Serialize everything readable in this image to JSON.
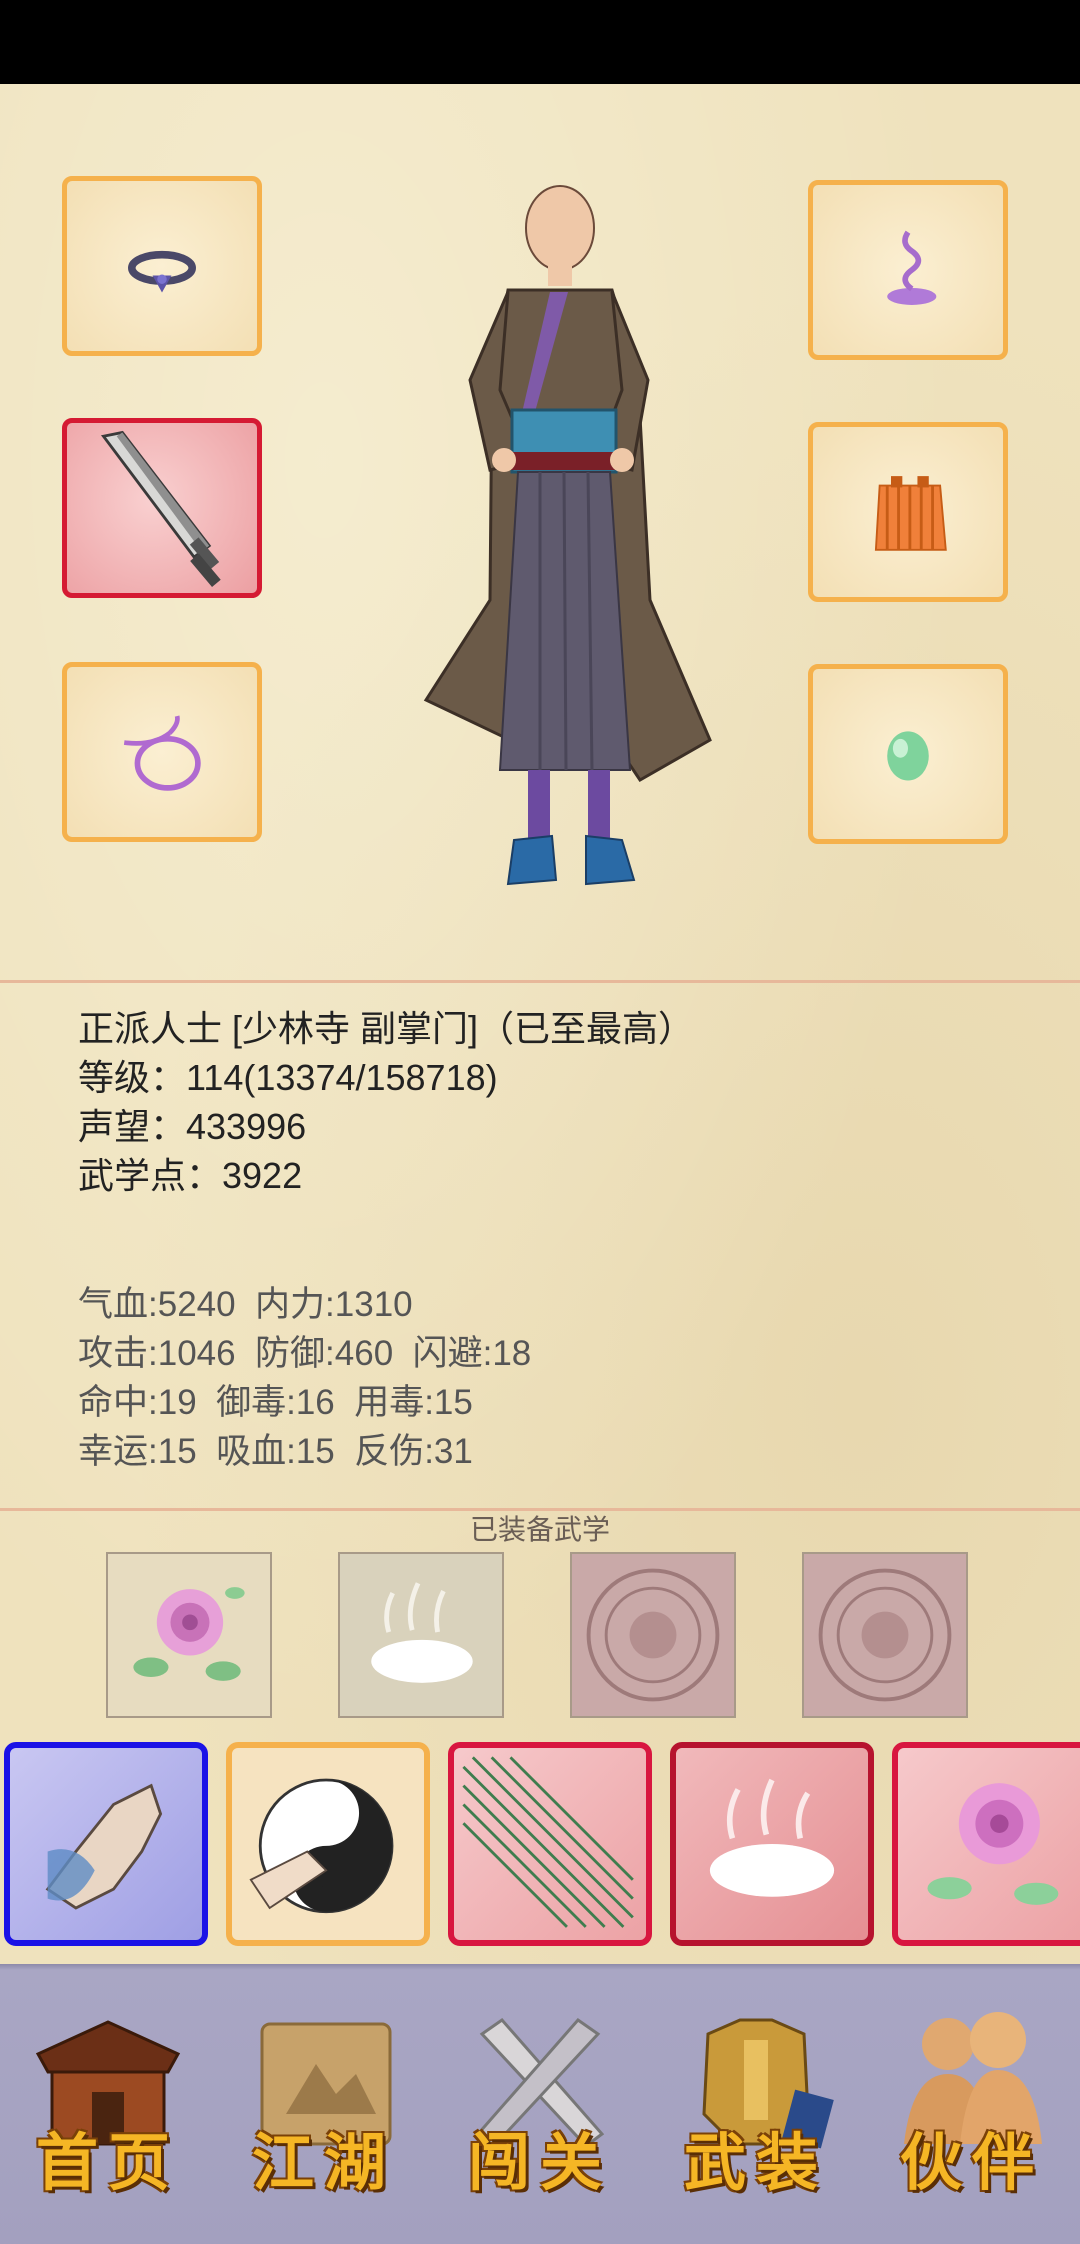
{
  "character": {
    "title": "正派人士 [少林寺 副掌门]（已至最高）",
    "level": "等级：114(13374/158718)",
    "reputation": "声望：433996",
    "martial_points": "武学点：3922"
  },
  "stats": {
    "line1": "气血:5240  内力:1310",
    "line2": "攻击:1046  防御:460  闪避:18",
    "line3": "命中:19  御毒:16  用毒:15",
    "line4": "幸运:15  吸血:15  反伤:31"
  },
  "equipped_martial": {
    "label": "已装备武学"
  },
  "nav": {
    "home": "首页",
    "jianghu": "江湖",
    "challenge": "闯关",
    "equipment": "武装",
    "partner": "伙伴"
  },
  "colors": {
    "slot_border": "#f5b14c",
    "slot_red_border": "#d51a33",
    "skill_blue_border": "#1b12e6",
    "nav_text": "#f5b625"
  }
}
